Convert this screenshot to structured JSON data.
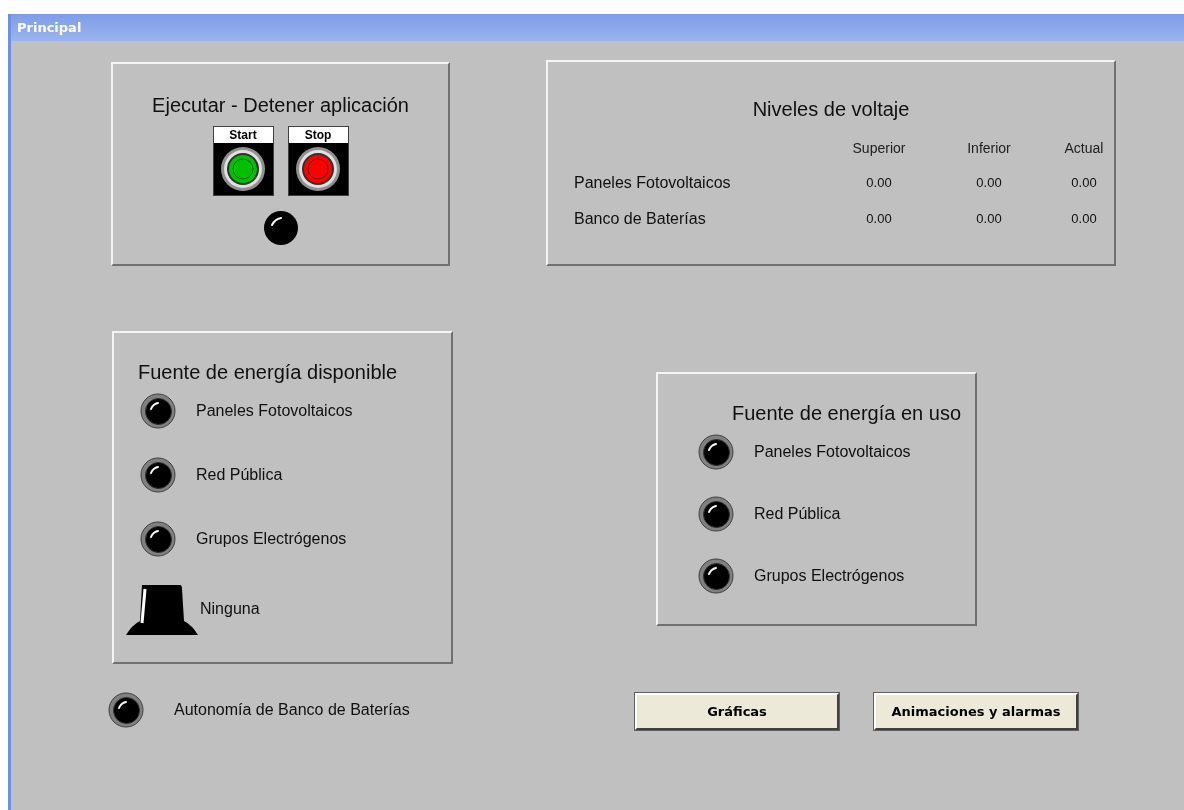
{
  "window": {
    "title": "Principal"
  },
  "run_panel": {
    "title": "Ejecutar - Detener aplicación",
    "buttons": [
      {
        "label": "Start",
        "color": "#00c000"
      },
      {
        "label": "Stop",
        "color": "#ff0000"
      }
    ],
    "status_lamp": {
      "on": false
    }
  },
  "voltage_panel": {
    "title": "Niveles de voltaje",
    "columns": [
      "Superior",
      "Inferior",
      "Actual"
    ],
    "rows": [
      {
        "label": "Paneles Fotovoltaicos",
        "values": [
          "0.00",
          "0.00",
          "0.00"
        ]
      },
      {
        "label": "Banco de Baterías",
        "values": [
          "0.00",
          "0.00",
          "0.00"
        ]
      }
    ]
  },
  "available_panel": {
    "title": "Fuente de energía disponible",
    "items": [
      {
        "kind": "lamp",
        "label": "Paneles Fotovoltaicos",
        "on": false
      },
      {
        "kind": "lamp",
        "label": "Red Pública",
        "on": false
      },
      {
        "kind": "lamp",
        "label": "Grupos Electrógenos",
        "on": false
      },
      {
        "kind": "beacon",
        "label": "Ninguna",
        "on": false
      }
    ]
  },
  "in_use_panel": {
    "title": "Fuente de energía en uso",
    "items": [
      {
        "kind": "lamp",
        "label": "Paneles Fotovoltaicos",
        "on": false
      },
      {
        "kind": "lamp",
        "label": "Red Pública",
        "on": false
      },
      {
        "kind": "lamp",
        "label": "Grupos Electrógenos",
        "on": false
      }
    ]
  },
  "battery_autonomy": {
    "label": "Autonomía de Banco de Baterías",
    "on": false
  },
  "buttons": [
    {
      "label": "Gráficas"
    },
    {
      "label": "Animaciones y alarmas"
    }
  ]
}
